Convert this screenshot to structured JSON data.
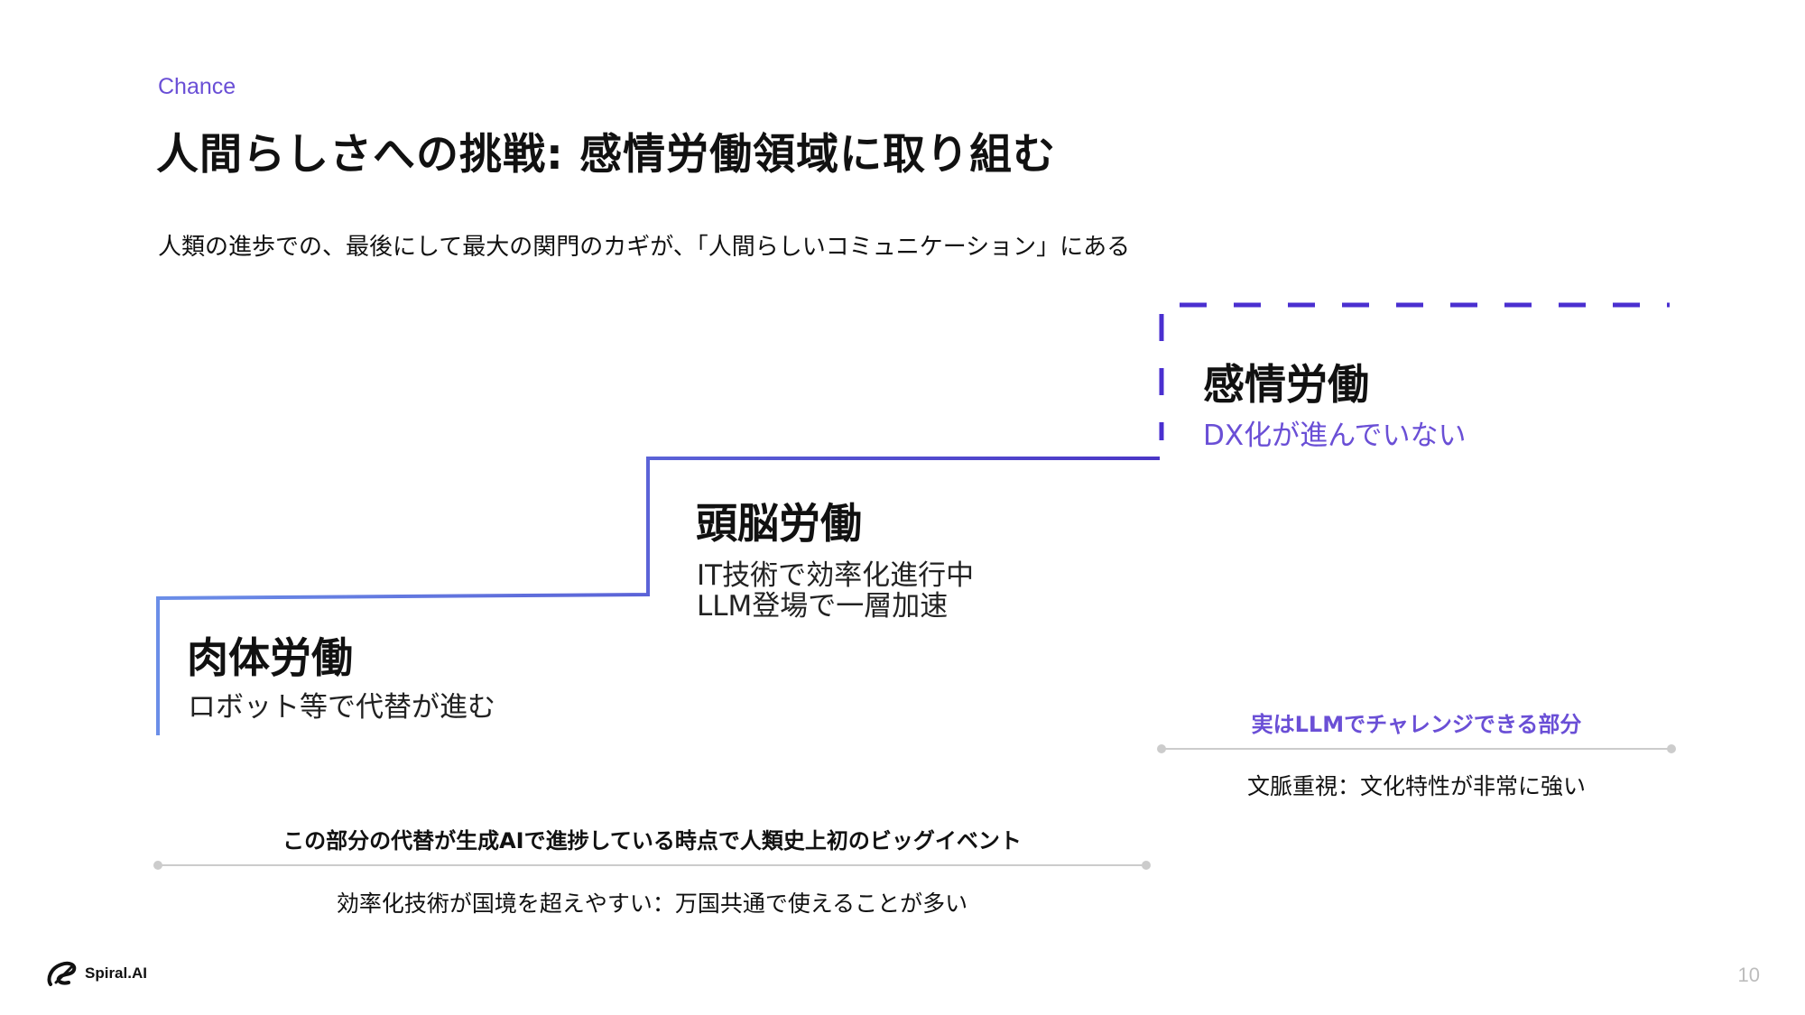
{
  "header": {
    "eyebrow": "Chance",
    "title": "人間らしさへの挑戦: 感情労働領域に取り組む",
    "subtitle": "人類の進歩での、最後にして最大の関門のカギが、「人間らしいコミュニケーション」にある"
  },
  "steps": [
    {
      "title": "肉体労働",
      "lines": [
        "ロボット等で代替が進む"
      ]
    },
    {
      "title": "頭脳労働",
      "lines": [
        "IT技術で効率化進行中",
        "LLM登場で一層加速"
      ]
    },
    {
      "title": "感情労働",
      "lines": [
        "DX化が進んでいない"
      ]
    }
  ],
  "notes": {
    "left": {
      "label": "この部分の代替が生成AIで進捗している時点で人類史上初のビッグイベント",
      "sub": "効率化技術が国境を超えやすい：万国共通で使えることが多い"
    },
    "right": {
      "label": "実はLLMでチャレンジできる部分",
      "sub": "文脈重視：文化特性が非常に強い"
    }
  },
  "footer": {
    "logo_text": "Spiral.AI",
    "page_number": "10"
  },
  "colors": {
    "accent": "#6a4fd6",
    "stair_start": "#6b8ee8",
    "stair_end": "#4a36c6",
    "dashed": "#4a2fd0",
    "rule": "#cccccc"
  }
}
